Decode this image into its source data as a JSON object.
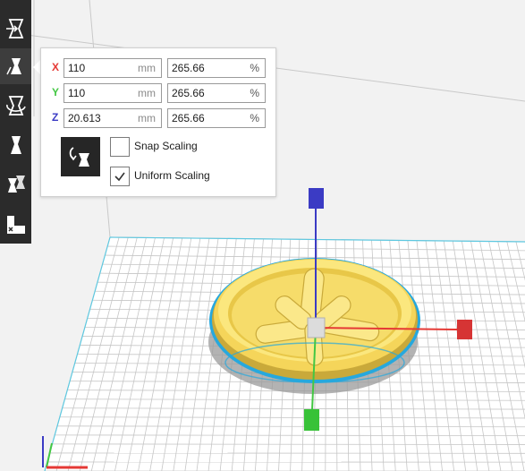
{
  "colors": {
    "axis_x": "#e53935",
    "axis_y": "#43c743",
    "axis_z": "#3b3bc4",
    "model": "#f7e26b",
    "selection_outline": "#2aa3dc",
    "toolbar_bg": "#2b2b2b"
  },
  "toolbar": {
    "tools": [
      {
        "icon": "move-tool-icon"
      },
      {
        "icon": "scale-tool-icon"
      },
      {
        "icon": "rotate-tool-icon"
      },
      {
        "icon": "mirror-tool-icon"
      },
      {
        "icon": "per-model-settings-icon"
      },
      {
        "icon": "support-blocker-icon"
      }
    ],
    "active_tool": 1
  },
  "scale_panel": {
    "rows": [
      {
        "axis": "X",
        "mm": "110",
        "mm_unit": "mm",
        "percent": "265.66",
        "percent_unit": "%"
      },
      {
        "axis": "Y",
        "mm": "110",
        "mm_unit": "mm",
        "percent": "265.66",
        "percent_unit": "%"
      },
      {
        "axis": "Z",
        "mm": "20.613",
        "mm_unit": "mm",
        "percent": "265.66",
        "percent_unit": "%"
      }
    ],
    "snap_scaling": {
      "label": "Snap Scaling",
      "checked": false
    },
    "uniform_scaling": {
      "label": "Uniform Scaling",
      "checked": true
    }
  }
}
